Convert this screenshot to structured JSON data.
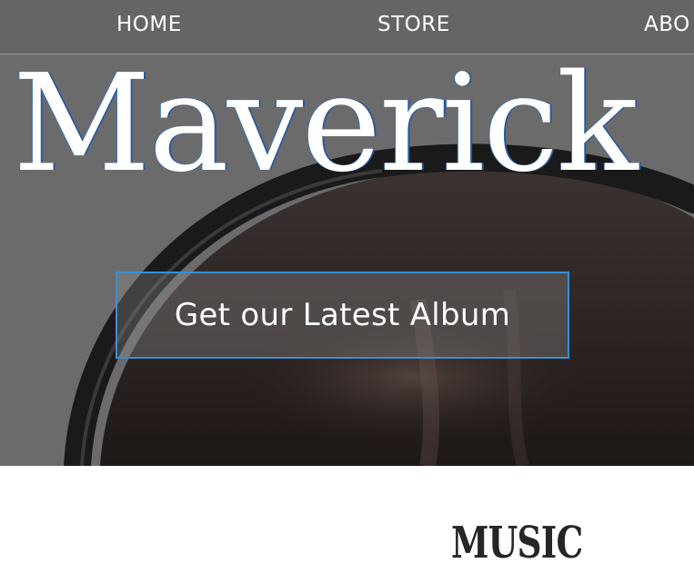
{
  "nav": {
    "items": [
      {
        "label": "HOME"
      },
      {
        "label": "STORE"
      },
      {
        "label": "ABO"
      }
    ]
  },
  "hero": {
    "band_name": "Maverick",
    "cta_label": "Get our Latest Album"
  },
  "sections": {
    "music_heading": "MUSIC"
  },
  "colors": {
    "accent_border": "#3a8fd0",
    "nav_text": "#ffffff",
    "heading_text": "#262626"
  }
}
